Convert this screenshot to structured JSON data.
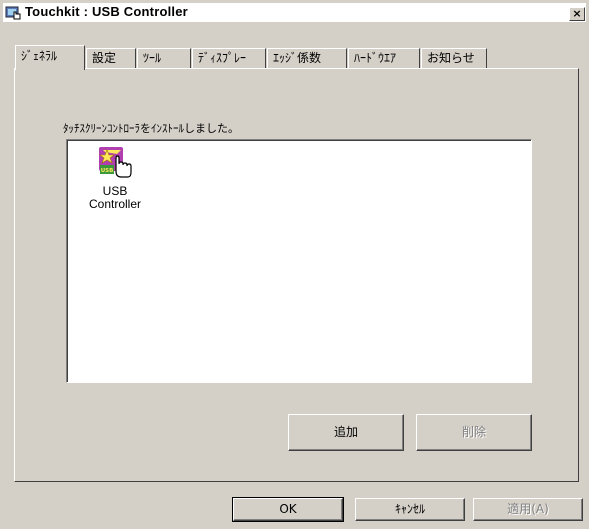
{
  "window": {
    "title": "Touchkit : USB Controller",
    "close_glyph": "×"
  },
  "tabs": [
    {
      "label": "ｼﾞｪﾈﾗﾙ",
      "active": true
    },
    {
      "label": "設定"
    },
    {
      "label": "ﾂｰﾙ"
    },
    {
      "label": "ﾃﾞｨｽﾌﾟﾚｰ"
    },
    {
      "label": "ｴｯｼﾞ係数"
    },
    {
      "label": "ﾊｰﾄﾞｳｴｱ"
    },
    {
      "label": "お知らせ"
    }
  ],
  "general": {
    "message": "ﾀｯﾁｽｸﾘｰﾝｺﾝﾄﾛｰﾗをｲﾝｽﾄｰﾙしました。",
    "devices": [
      {
        "label_line1": "USB",
        "label_line2": "Controller",
        "icon": "touchkit-usb-icon"
      }
    ],
    "add_button": "追加",
    "remove_button": "削除"
  },
  "footer": {
    "ok": "OK",
    "cancel": "ｷｬﾝｾﾙ",
    "apply": "適用(A)"
  }
}
